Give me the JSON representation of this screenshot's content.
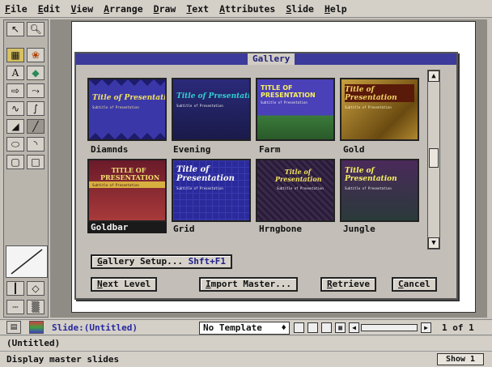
{
  "menu": [
    {
      "label": "File",
      "u": "F",
      "rest": "ile"
    },
    {
      "label": "Edit",
      "u": "E",
      "rest": "dit"
    },
    {
      "label": "View",
      "u": "V",
      "rest": "iew"
    },
    {
      "label": "Arrange",
      "u": "A",
      "rest": "rrange"
    },
    {
      "label": "Draw",
      "u": "D",
      "rest": "raw"
    },
    {
      "label": "Text",
      "u": "T",
      "rest": "ext"
    },
    {
      "label": "Attributes",
      "u": "A",
      "rest": "ttributes"
    },
    {
      "label": "Slide",
      "u": "S",
      "rest": "lide"
    },
    {
      "label": "Help",
      "u": "H",
      "rest": "elp"
    }
  ],
  "gallery": {
    "title": "Gallery",
    "items": [
      {
        "name": "Diamnds",
        "thumb_title": "Title of Presentation",
        "thumb_sub": "Subtitle of Presentation"
      },
      {
        "name": "Evening",
        "thumb_title": "Title of Presentation",
        "thumb_sub": "Subtitle of Presentation"
      },
      {
        "name": "Farm",
        "thumb_title": "TITLE OF PRESENTATION",
        "thumb_sub": "Subtitle of Presentation"
      },
      {
        "name": "Gold",
        "thumb_title": "Title of Presentation",
        "thumb_sub": "Subtitle of Presentation"
      },
      {
        "name": "Goldbar",
        "thumb_title": "TITLE OF PRESENTATION",
        "thumb_sub": "Subtitle of Presentation",
        "selected": true
      },
      {
        "name": "Grid",
        "thumb_title": "Title of Presentation",
        "thumb_sub": "Subtitle of Presentation"
      },
      {
        "name": "Hrngbone",
        "thumb_title": "Title of Presentation",
        "thumb_sub": "Subtitle of Presentation"
      },
      {
        "name": "Jungle",
        "thumb_title": "Title of Presentation",
        "thumb_sub": "Subtitle of Presentation"
      }
    ],
    "setup_button": {
      "u": "G",
      "label": "allery Setup...",
      "shortcut": "Shft+F1"
    },
    "buttons": [
      {
        "u": "N",
        "label": "ext Level"
      },
      {
        "u": "I",
        "label": "mport Master..."
      },
      {
        "u": "R",
        "label": "etrieve"
      },
      {
        "u": "C",
        "label": "ancel"
      }
    ]
  },
  "status": {
    "slide_label": "Slide:(Untitled)",
    "template": "No Template",
    "page_of": "1 of  1",
    "line2": "(Untitled)",
    "line3": "Display master slides",
    "show_button": "Show 1"
  },
  "colors": {
    "title_bar": "#3c3a9a",
    "selection": "#1a1a1a",
    "accent_text": "#2828a0"
  }
}
